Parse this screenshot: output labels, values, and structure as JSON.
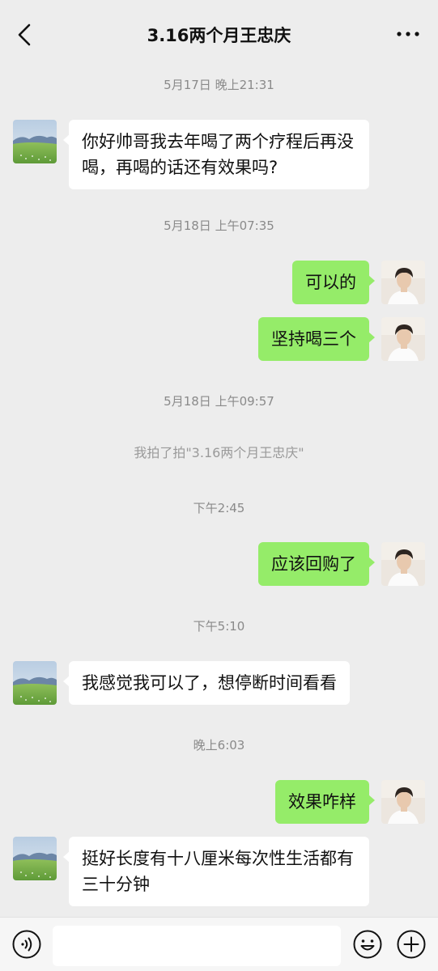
{
  "header": {
    "title": "3.16两个月王忠庆",
    "back_icon": "chevron-left-icon",
    "more_icon": "ellipsis-icon"
  },
  "colors": {
    "background": "#ededed",
    "bubble_self": "#95ec69",
    "bubble_other": "#ffffff",
    "text": "#111111",
    "timestamp": "#8a8a8a"
  },
  "chat": {
    "ts1": "5月17日 晚上21:31",
    "msg1": "你好帅哥我去年喝了两个疗程后再没喝，再喝的话还有效果吗?",
    "ts2": "5月18日 上午07:35",
    "msg2": "可以的",
    "msg3": "坚持喝三个",
    "ts3": "5月18日 上午09:57",
    "sys1": "我拍了拍\"3.16两个月王忠庆\"",
    "ts4": "下午2:45",
    "msg4": "应该回购了",
    "ts5": "下午5:10",
    "msg5": "我感觉我可以了，想停断时间看看",
    "ts6": "晚上6:03",
    "msg6": "效果咋样",
    "msg7": "挺好长度有十八厘米每次性生活都有三十分钟"
  },
  "input_bar": {
    "value": "",
    "voice_icon": "voice-icon",
    "emoji_icon": "emoji-icon",
    "plus_icon": "plus-icon"
  }
}
